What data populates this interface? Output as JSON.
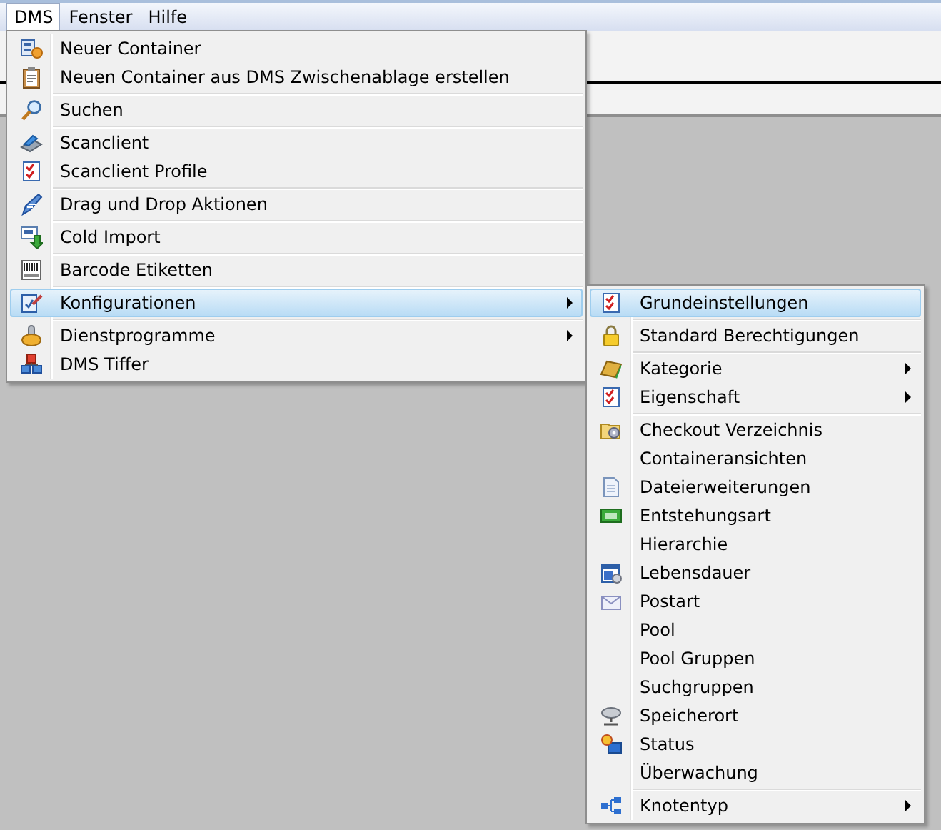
{
  "menubar": [
    {
      "label": "DMS",
      "selected": true
    },
    {
      "label": "Fenster",
      "selected": false
    },
    {
      "label": "Hilfe",
      "selected": false
    }
  ],
  "menu": {
    "groups": [
      [
        {
          "label": "Neuer Container",
          "submenu": false,
          "selected": false
        },
        {
          "label": "Neuen Container aus DMS Zwischenablage erstellen",
          "submenu": false,
          "selected": false
        }
      ],
      [
        {
          "label": "Suchen",
          "submenu": false,
          "selected": false
        }
      ],
      [
        {
          "label": "Scanclient",
          "submenu": false,
          "selected": false
        },
        {
          "label": "Scanclient Profile",
          "submenu": false,
          "selected": false
        }
      ],
      [
        {
          "label": "Drag und Drop Aktionen",
          "submenu": false,
          "selected": false
        }
      ],
      [
        {
          "label": "Cold Import",
          "submenu": false,
          "selected": false
        }
      ],
      [
        {
          "label": "Barcode Etiketten",
          "submenu": false,
          "selected": false
        }
      ],
      [
        {
          "label": "Konfigurationen",
          "submenu": true,
          "selected": true
        }
      ],
      [
        {
          "label": "Dienstprogramme",
          "submenu": true,
          "selected": false
        },
        {
          "label": "DMS Tiffer",
          "submenu": false,
          "selected": false
        }
      ]
    ]
  },
  "submenu": {
    "groups": [
      [
        {
          "label": "Grundeinstellungen",
          "submenu": false,
          "selected": true
        }
      ],
      [
        {
          "label": "Standard Berechtigungen",
          "submenu": false,
          "selected": false
        }
      ],
      [
        {
          "label": "Kategorie",
          "submenu": true,
          "selected": false
        },
        {
          "label": "Eigenschaft",
          "submenu": true,
          "selected": false
        }
      ],
      [
        {
          "label": "Checkout Verzeichnis",
          "submenu": false,
          "selected": false
        },
        {
          "label": "Containeransichten",
          "submenu": false,
          "selected": false
        },
        {
          "label": "Dateierweiterungen",
          "submenu": false,
          "selected": false
        },
        {
          "label": "Entstehungsart",
          "submenu": false,
          "selected": false
        },
        {
          "label": "Hierarchie",
          "submenu": false,
          "selected": false
        },
        {
          "label": "Lebensdauer",
          "submenu": false,
          "selected": false
        },
        {
          "label": "Postart",
          "submenu": false,
          "selected": false
        },
        {
          "label": "Pool",
          "submenu": false,
          "selected": false
        },
        {
          "label": "Pool Gruppen",
          "submenu": false,
          "selected": false
        },
        {
          "label": "Suchgruppen",
          "submenu": false,
          "selected": false
        },
        {
          "label": "Speicherort",
          "submenu": false,
          "selected": false
        },
        {
          "label": "Status",
          "submenu": false,
          "selected": false
        },
        {
          "label": "Überwachung",
          "submenu": false,
          "selected": false
        }
      ],
      [
        {
          "label": "Knotentyp",
          "submenu": true,
          "selected": false
        }
      ]
    ]
  }
}
